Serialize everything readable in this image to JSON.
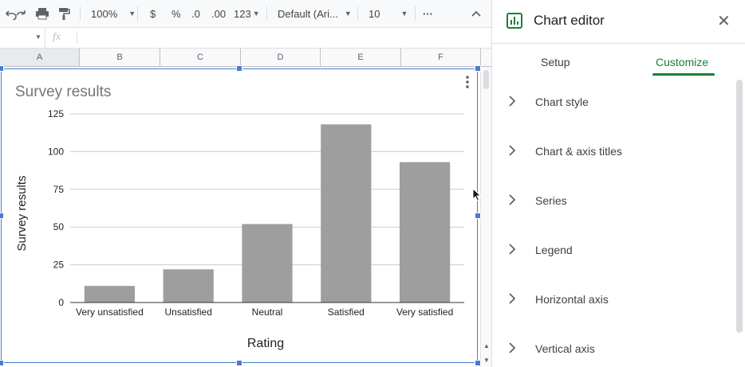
{
  "toolbar": {
    "zoom": "100%",
    "currency": "$",
    "percent": "%",
    "dec_decrease": ".0",
    "dec_increase": ".00",
    "format_more": "123",
    "font": "Default (Ari...",
    "font_size": "10",
    "more": "···"
  },
  "formula_bar": {
    "fx": "fx"
  },
  "columns": [
    "A",
    "B",
    "C",
    "D",
    "E",
    "F"
  ],
  "chart_data": {
    "type": "bar",
    "title": "Survey results",
    "xlabel": "Rating",
    "ylabel": "Survey results",
    "categories": [
      "Very unsatisfied",
      "Unsatisfied",
      "Neutral",
      "Satisfied",
      "Very satisfied"
    ],
    "values": [
      11,
      22,
      52,
      118,
      93
    ],
    "ylim": [
      0,
      125
    ],
    "yticks": [
      0,
      25,
      50,
      75,
      100,
      125
    ],
    "grid": true,
    "bar_color": "#9e9e9e"
  },
  "editor": {
    "title": "Chart editor",
    "tabs": [
      {
        "label": "Setup",
        "active": false
      },
      {
        "label": "Customize",
        "active": true
      }
    ],
    "sections": [
      "Chart style",
      "Chart & axis titles",
      "Series",
      "Legend",
      "Horizontal axis",
      "Vertical axis"
    ],
    "accent": "#188038"
  }
}
